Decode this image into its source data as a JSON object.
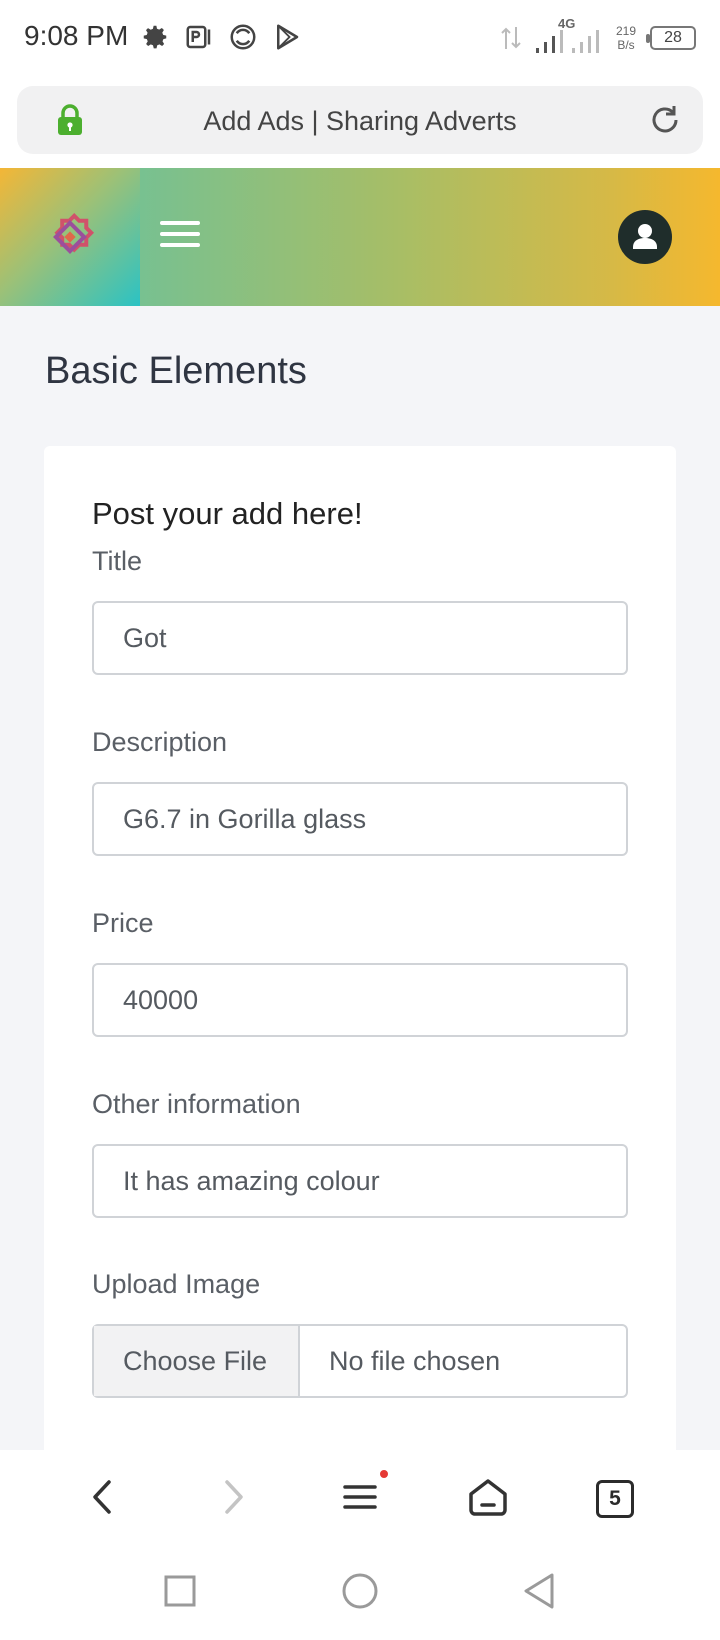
{
  "status_bar": {
    "time": "9:08 PM",
    "network_type": "4G",
    "net_speed_value": "219",
    "net_speed_unit": "B/s",
    "battery": "28",
    "icons": [
      "gear-icon",
      "parking-app-icon",
      "aperture-icon",
      "play-store-icon",
      "data-arrows-icon",
      "signal-icon",
      "battery-icon"
    ]
  },
  "browser": {
    "page_title": "Add Ads | Sharing Adverts",
    "secure_icon": "lock-icon",
    "reload_icon": "reload-icon",
    "tab_count": "5"
  },
  "app_header": {
    "logo_icon": "gear-logo-icon",
    "menu_icon": "hamburger-menu-icon",
    "profile_icon": "user-avatar-icon"
  },
  "page": {
    "heading": "Basic Elements",
    "form": {
      "title": "Post your add here!",
      "fields": [
        {
          "label": "Title",
          "value": "Got"
        },
        {
          "label": "Description",
          "value": "G6.7 in Gorilla glass"
        },
        {
          "label": "Price",
          "value": "40000"
        },
        {
          "label": "Other information",
          "value": "It has amazing colour"
        }
      ],
      "upload": {
        "label": "Upload Image",
        "button": "Choose File",
        "status": "No file chosen"
      }
    }
  },
  "colors": {
    "header_gradient_start": "#5ec4a8",
    "header_gradient_end": "#f5b82e",
    "lock_green": "#4caf2f",
    "logo_red": "#d0526a",
    "notification_red": "#e53935"
  }
}
